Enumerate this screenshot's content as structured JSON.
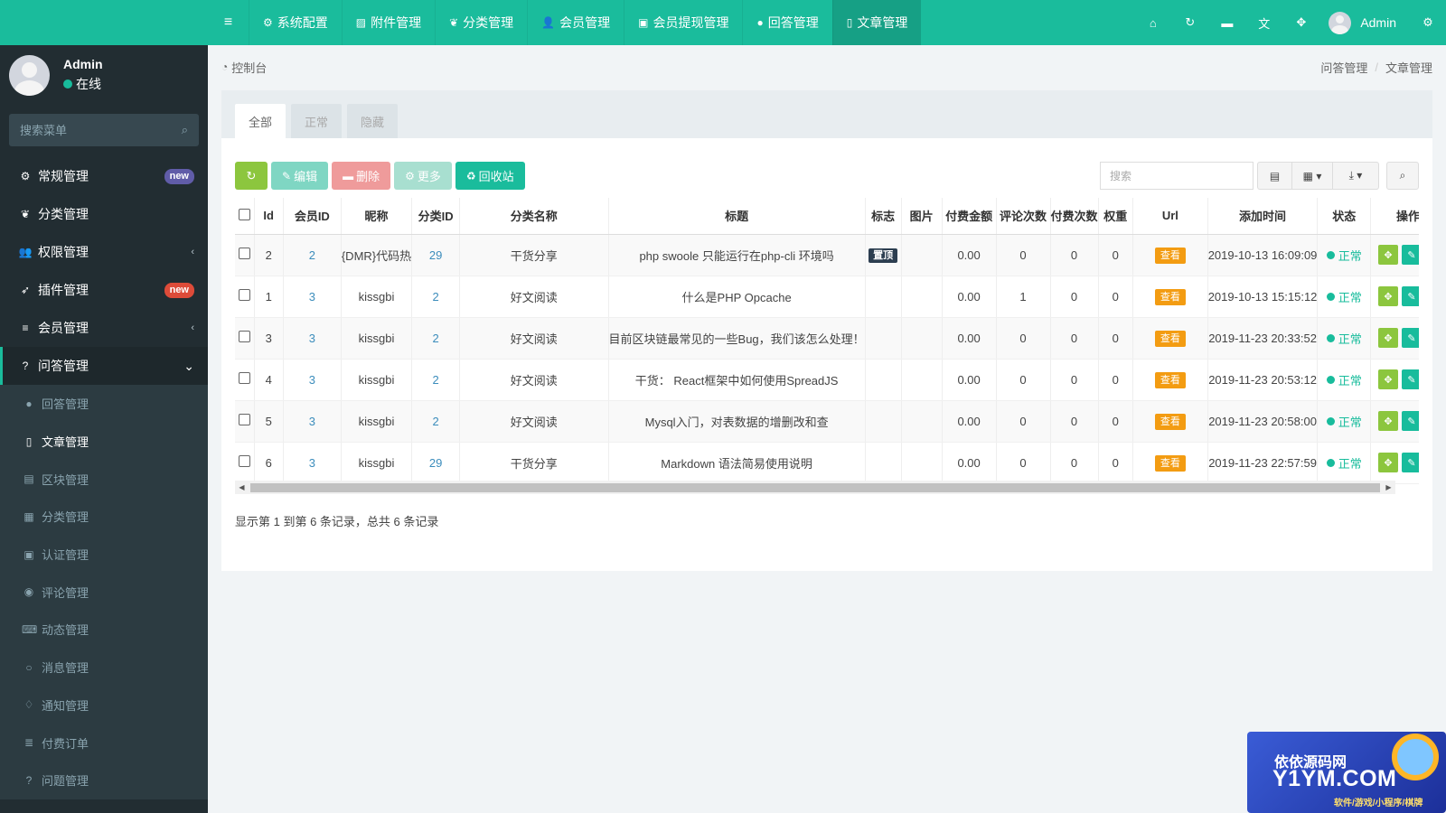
{
  "sidebar": {
    "user": {
      "name": "Admin",
      "status": "在线"
    },
    "search_placeholder": "搜索菜单",
    "items": [
      {
        "label": "常规管理",
        "icon": "cogs-icon",
        "glyph": "⚙",
        "badge": "new",
        "badge_color": "#605ca8"
      },
      {
        "label": "分类管理",
        "icon": "leaf-icon",
        "glyph": "❦"
      },
      {
        "label": "权限管理",
        "icon": "group-icon",
        "glyph": "👥",
        "chevron": "‹"
      },
      {
        "label": "插件管理",
        "icon": "rocket-icon",
        "glyph": "➶",
        "badge": "new",
        "badge_color": "#dd4b39"
      },
      {
        "label": "会员管理",
        "icon": "list-icon",
        "glyph": "≡",
        "chevron": "‹"
      },
      {
        "label": "问答管理",
        "icon": "question-circle-icon",
        "glyph": "?",
        "chevron": "⌄"
      }
    ],
    "sub_items": [
      {
        "label": "回答管理",
        "icon": "comment-icon",
        "glyph": "●"
      },
      {
        "label": "文章管理",
        "icon": "file-icon",
        "glyph": "▯"
      },
      {
        "label": "区块管理",
        "icon": "file-text-icon",
        "glyph": "▤"
      },
      {
        "label": "分类管理",
        "icon": "archive-icon",
        "glyph": "▦"
      },
      {
        "label": "认证管理",
        "icon": "id-card-icon",
        "glyph": "▣"
      },
      {
        "label": "评论管理",
        "icon": "comments-icon",
        "glyph": "◉"
      },
      {
        "label": "动态管理",
        "icon": "keyboard-icon",
        "glyph": "⌨"
      },
      {
        "label": "消息管理",
        "icon": "comment-o-icon",
        "glyph": "○"
      },
      {
        "label": "通知管理",
        "icon": "bell-icon",
        "glyph": "♢"
      },
      {
        "label": "付费订单",
        "icon": "list-icon",
        "glyph": "≣"
      },
      {
        "label": "问题管理",
        "icon": "question-circle-o-icon",
        "glyph": "?"
      }
    ]
  },
  "topbar": {
    "toggle_glyph": "≡",
    "tabs": [
      {
        "label": "系统配置",
        "icon": "gear-icon",
        "glyph": "⚙"
      },
      {
        "label": "附件管理",
        "icon": "file-image-icon",
        "glyph": "▨"
      },
      {
        "label": "分类管理",
        "icon": "leaf-icon",
        "glyph": "❦"
      },
      {
        "label": "会员管理",
        "icon": "user-icon",
        "glyph": "👤"
      },
      {
        "label": "会员提现管理",
        "icon": "money-icon",
        "glyph": "▣"
      },
      {
        "label": "回答管理",
        "icon": "comment-icon",
        "glyph": "●"
      },
      {
        "label": "文章管理",
        "icon": "file-icon",
        "glyph": "▯"
      }
    ],
    "right_icons": [
      {
        "icon": "home-icon",
        "glyph": "⌂"
      },
      {
        "icon": "refresh-icon",
        "glyph": "↻"
      },
      {
        "icon": "trash-icon",
        "glyph": "▬"
      },
      {
        "icon": "language-icon",
        "glyph": "文"
      },
      {
        "icon": "fullscreen-icon",
        "glyph": "✥"
      }
    ],
    "user_name": "Admin",
    "settings_glyph": "⚙"
  },
  "content_header": {
    "title": "控制台",
    "breadcrumb": [
      "问答管理",
      "文章管理"
    ]
  },
  "panel": {
    "tabs": [
      "全部",
      "正常",
      "隐藏"
    ],
    "toolbar": {
      "edit": "编辑",
      "delete": "删除",
      "more": "更多",
      "recycle": "回收站"
    },
    "search_placeholder": "搜索",
    "columns": [
      "Id",
      "会员ID",
      "昵称",
      "分类ID",
      "分类名称",
      "标题",
      "标志",
      "图片",
      "付费金额",
      "评论次数",
      "付费次数",
      "权重",
      "Url",
      "添加时间",
      "状态",
      "操作"
    ],
    "rows": [
      {
        "id": "2",
        "member_id": "2",
        "nickname": "{DMR}代码热",
        "category_id": "29",
        "category_name": "干货分享",
        "title": "php swoole 只能运行在php-cli 环境吗",
        "flag": "置顶",
        "amount": "0.00",
        "comments": "0",
        "paid": "0",
        "weight": "0",
        "url": "查看",
        "time": "2019-10-13 16:09:09",
        "status": "正常"
      },
      {
        "id": "1",
        "member_id": "3",
        "nickname": "kissgbi",
        "category_id": "2",
        "category_name": "好文阅读",
        "title": "什么是PHP Opcache",
        "flag": "",
        "amount": "0.00",
        "comments": "1",
        "paid": "0",
        "weight": "0",
        "url": "查看",
        "time": "2019-10-13 15:15:12",
        "status": "正常"
      },
      {
        "id": "3",
        "member_id": "3",
        "nickname": "kissgbi",
        "category_id": "2",
        "category_name": "好文阅读",
        "title": "目前区块链最常见的一些Bug，我们该怎么处理！",
        "flag": "",
        "amount": "0.00",
        "comments": "0",
        "paid": "0",
        "weight": "0",
        "url": "查看",
        "time": "2019-11-23 20:33:52",
        "status": "正常"
      },
      {
        "id": "4",
        "member_id": "3",
        "nickname": "kissgbi",
        "category_id": "2",
        "category_name": "好文阅读",
        "title": "干货： React框架中如何使用SpreadJS",
        "flag": "",
        "amount": "0.00",
        "comments": "0",
        "paid": "0",
        "weight": "0",
        "url": "查看",
        "time": "2019-11-23 20:53:12",
        "status": "正常"
      },
      {
        "id": "5",
        "member_id": "3",
        "nickname": "kissgbi",
        "category_id": "2",
        "category_name": "好文阅读",
        "title": "Mysql入门，对表数据的增删改和查",
        "flag": "",
        "amount": "0.00",
        "comments": "0",
        "paid": "0",
        "weight": "0",
        "url": "查看",
        "time": "2019-11-23 20:58:00",
        "status": "正常"
      },
      {
        "id": "6",
        "member_id": "3",
        "nickname": "kissgbi",
        "category_id": "29",
        "category_name": "干货分享",
        "title": "Markdown 语法简易使用说明",
        "flag": "",
        "amount": "0.00",
        "comments": "0",
        "paid": "0",
        "weight": "0",
        "url": "查看",
        "time": "2019-11-23 22:57:59",
        "status": "正常"
      }
    ],
    "pagination_text": "显示第 1 到第 6 条记录，总共 6 条记录"
  },
  "watermark": {
    "line1": "依依源码网",
    "line2": "Y1YM.COM",
    "line3": "软件/游戏/小程序/棋牌"
  },
  "colors": {
    "brand": "#1abc9c",
    "sidebar_bg": "#222d32",
    "warning": "#f39c12",
    "danger": "#e74c3c",
    "success": "#8cc63e"
  }
}
